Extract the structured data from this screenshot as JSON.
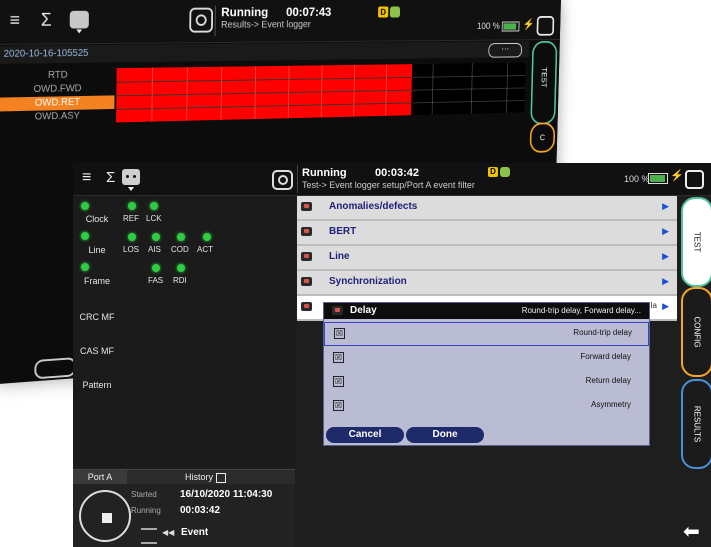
{
  "back_screen": {
    "status": "Running",
    "timer": "00:07:43",
    "path": "Results-> Event logger",
    "badge_d": "D",
    "battery": "100 %",
    "file_name": "2020-10-16-105525",
    "more_button": "···",
    "rows": [
      "RTD",
      "OWD.FWD",
      "OWD.RET",
      "OWD.ASY"
    ],
    "selected_row": "OWD.RET",
    "tab_test": "TEST",
    "tab_config_partial": "C"
  },
  "front_screen": {
    "status": "Running",
    "timer": "00:03:42",
    "path": "Test-> Event logger setup/Port A event filter",
    "badge_d": "D",
    "battery": "100 %",
    "indicators": {
      "clock": {
        "label": "Clock",
        "subs": [
          "REF",
          "LCK"
        ]
      },
      "line": {
        "label": "Line",
        "subs": [
          "LOS",
          "AIS",
          "COD",
          "ACT"
        ]
      },
      "frame": {
        "label": "Frame",
        "subs": [
          "FAS",
          "RDI"
        ]
      },
      "crc_mf": {
        "label": "CRC MF"
      },
      "cas_mf": {
        "label": "CAS MF"
      },
      "pattern": {
        "label": "Pattern"
      }
    },
    "port_tab": "Port A",
    "history_label": "History",
    "recording": {
      "started_label": "Started",
      "started_value": "16/10/2020 11:04:30",
      "running_label": "Running",
      "running_value": "00:03:42",
      "event_label": "Event"
    },
    "menu": [
      {
        "label": "Anomalies/defects"
      },
      {
        "label": "BERT"
      },
      {
        "label": "Line"
      },
      {
        "label": "Synchronization"
      },
      {
        "label": "Delay",
        "hidden_tail": "la"
      }
    ],
    "delay_popup": {
      "title": "Delay",
      "summary": "Round-trip delay, Forward delay...",
      "options": [
        "Round-trip delay",
        "Forward delay",
        "Return delay",
        "Asymmetry"
      ],
      "checked": [
        "☒",
        "☒",
        "☒",
        "☒"
      ],
      "cancel": "Cancel",
      "done": "Done"
    },
    "tabs": {
      "test": "TEST",
      "config": "CONFIG",
      "results": "RESULTS"
    },
    "colors": {
      "accent_test": "#4fc3a1",
      "accent_config": "#f5a623",
      "accent_results": "#4a90d9",
      "highlight": "#f58220",
      "event_red": "#ff0000"
    }
  }
}
